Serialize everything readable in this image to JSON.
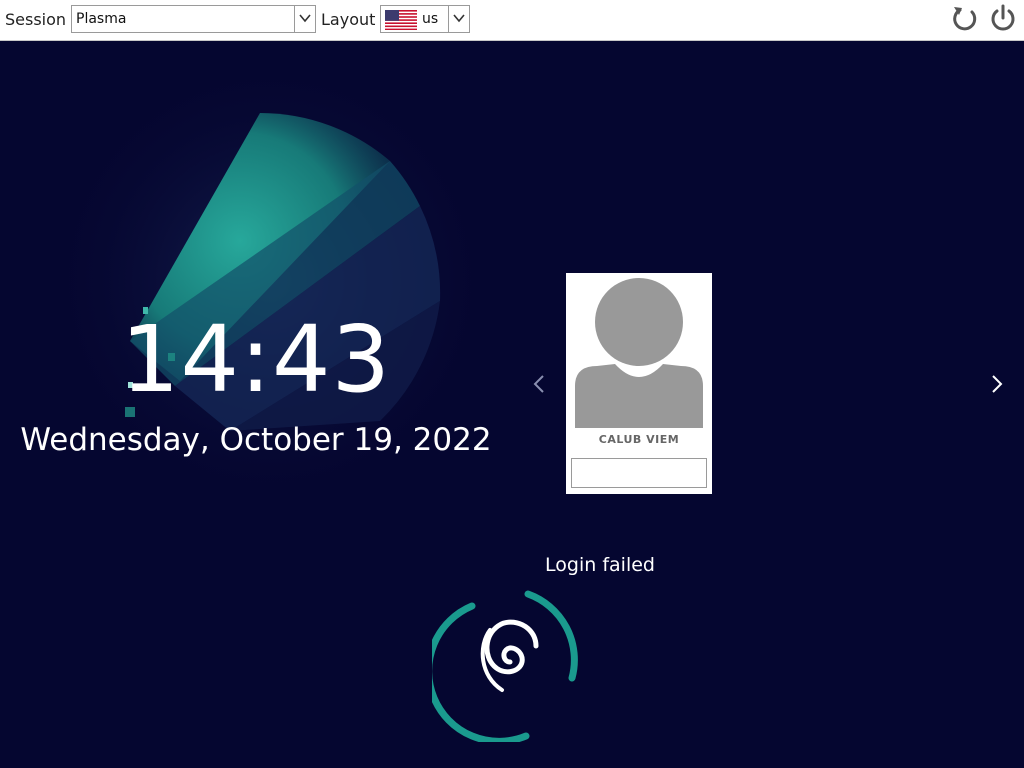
{
  "topbar": {
    "session_label": "Session",
    "session_value": "Plasma",
    "layout_label": "Layout",
    "layout_value": "us",
    "layout_flag_icon": "us-flag-icon",
    "reboot_icon": "reboot-icon",
    "shutdown_icon": "power-icon"
  },
  "clock": {
    "time": "14:43",
    "date": "Wednesday, October 19, 2022"
  },
  "user": {
    "name": "CALUB VIEM",
    "password_value": ""
  },
  "navigation": {
    "prev_icon": "chevron-left-icon",
    "next_icon": "chevron-right-icon"
  },
  "status": {
    "message": "Login failed"
  },
  "colors": {
    "background": "#050630",
    "accent": "#1a9a8e",
    "topbar": "#ffffff",
    "avatar": "#999999"
  }
}
